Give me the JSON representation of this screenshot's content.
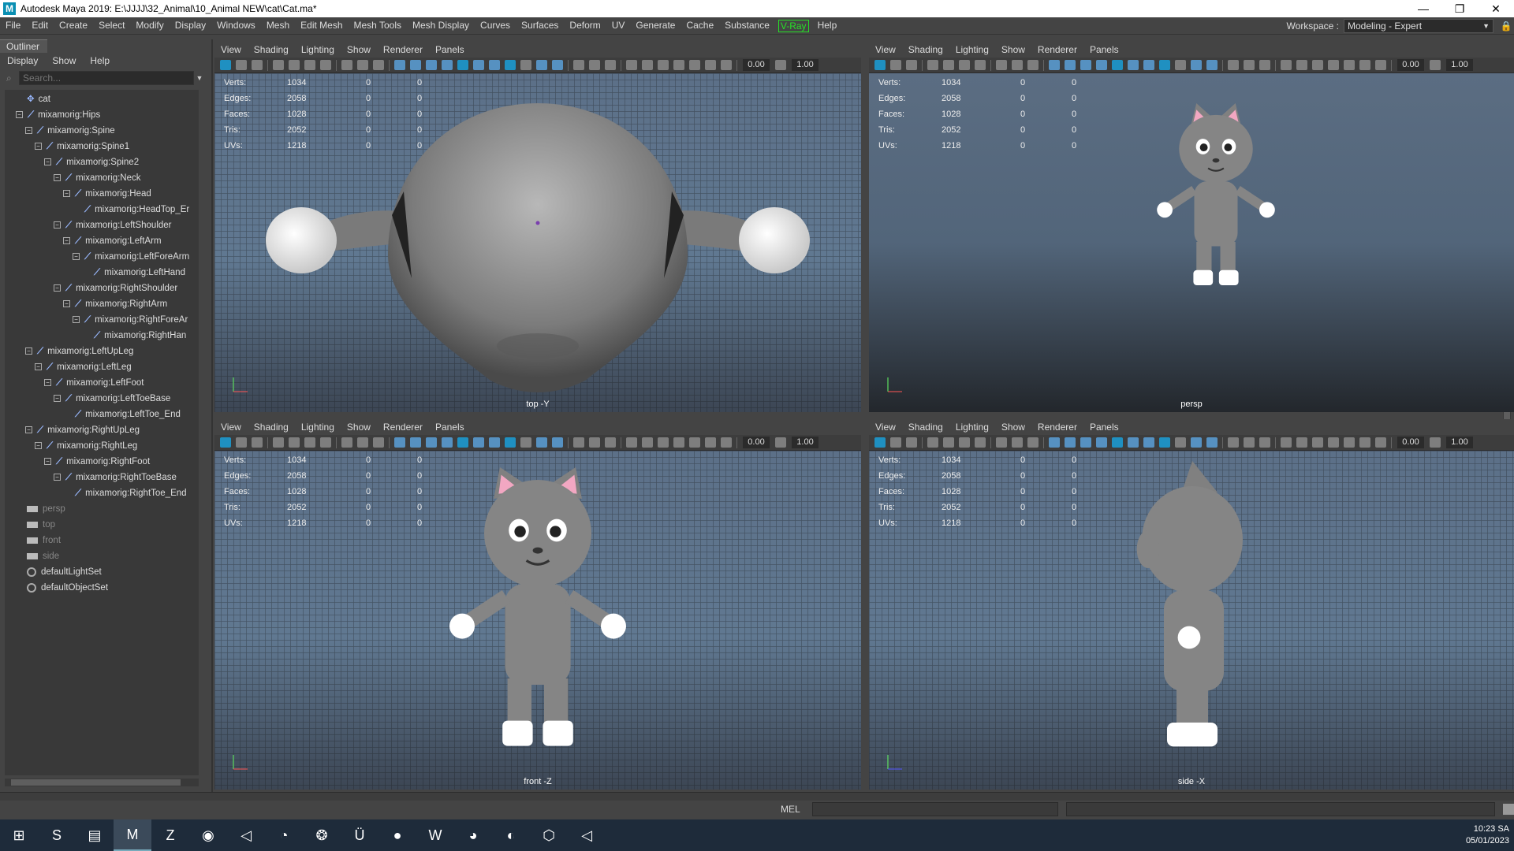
{
  "titlebar": {
    "title": "Autodesk Maya 2019: E:\\JJJJ\\32_Animal\\10_Animal NEW\\cat\\Cat.ma*",
    "logo": "M",
    "minimize": "—",
    "restore": "❐",
    "close": "✕"
  },
  "menubar": {
    "items": [
      "File",
      "Edit",
      "Create",
      "Select",
      "Modify",
      "Display",
      "Windows",
      "Mesh",
      "Edit Mesh",
      "Mesh Tools",
      "Mesh Display",
      "Curves",
      "Surfaces",
      "Deform",
      "UV",
      "Generate",
      "Cache",
      "Substance",
      "V-Ray",
      "Help"
    ],
    "workspace_label": "Workspace :",
    "workspace_value": "Modeling - Expert"
  },
  "outliner": {
    "tab": "Outliner",
    "menu": [
      "Display",
      "Show",
      "Help"
    ],
    "search_placeholder": "Search...",
    "items": [
      {
        "label": "cat",
        "indent": 0,
        "kind": "root"
      },
      {
        "label": "mixamorig:Hips",
        "indent": 0,
        "kind": "joint",
        "exp": true
      },
      {
        "label": "mixamorig:Spine",
        "indent": 1,
        "kind": "joint",
        "exp": true
      },
      {
        "label": "mixamorig:Spine1",
        "indent": 2,
        "kind": "joint",
        "exp": true
      },
      {
        "label": "mixamorig:Spine2",
        "indent": 3,
        "kind": "joint",
        "exp": true
      },
      {
        "label": "mixamorig:Neck",
        "indent": 4,
        "kind": "joint",
        "exp": true
      },
      {
        "label": "mixamorig:Head",
        "indent": 5,
        "kind": "joint",
        "exp": true
      },
      {
        "label": "mixamorig:HeadTop_Er",
        "indent": 6,
        "kind": "joint"
      },
      {
        "label": "mixamorig:LeftShoulder",
        "indent": 4,
        "kind": "joint",
        "exp": true
      },
      {
        "label": "mixamorig:LeftArm",
        "indent": 5,
        "kind": "joint",
        "exp": true
      },
      {
        "label": "mixamorig:LeftForeArm",
        "indent": 6,
        "kind": "joint",
        "exp": true
      },
      {
        "label": "mixamorig:LeftHand",
        "indent": 7,
        "kind": "joint"
      },
      {
        "label": "mixamorig:RightShoulder",
        "indent": 4,
        "kind": "joint",
        "exp": true
      },
      {
        "label": "mixamorig:RightArm",
        "indent": 5,
        "kind": "joint",
        "exp": true
      },
      {
        "label": "mixamorig:RightForeAr",
        "indent": 6,
        "kind": "joint",
        "exp": true
      },
      {
        "label": "mixamorig:RightHan",
        "indent": 7,
        "kind": "joint"
      },
      {
        "label": "mixamorig:LeftUpLeg",
        "indent": 1,
        "kind": "joint",
        "exp": true
      },
      {
        "label": "mixamorig:LeftLeg",
        "indent": 2,
        "kind": "joint",
        "exp": true
      },
      {
        "label": "mixamorig:LeftFoot",
        "indent": 3,
        "kind": "joint",
        "exp": true
      },
      {
        "label": "mixamorig:LeftToeBase",
        "indent": 4,
        "kind": "joint",
        "exp": true
      },
      {
        "label": "mixamorig:LeftToe_End",
        "indent": 5,
        "kind": "joint"
      },
      {
        "label": "mixamorig:RightUpLeg",
        "indent": 1,
        "kind": "joint",
        "exp": true
      },
      {
        "label": "mixamorig:RightLeg",
        "indent": 2,
        "kind": "joint",
        "exp": true
      },
      {
        "label": "mixamorig:RightFoot",
        "indent": 3,
        "kind": "joint",
        "exp": true
      },
      {
        "label": "mixamorig:RightToeBase",
        "indent": 4,
        "kind": "joint",
        "exp": true
      },
      {
        "label": "mixamorig:RightToe_End",
        "indent": 5,
        "kind": "joint"
      },
      {
        "label": "persp",
        "indent": 0,
        "kind": "camera"
      },
      {
        "label": "top",
        "indent": 0,
        "kind": "camera"
      },
      {
        "label": "front",
        "indent": 0,
        "kind": "camera"
      },
      {
        "label": "side",
        "indent": 0,
        "kind": "camera"
      },
      {
        "label": "defaultLightSet",
        "indent": 0,
        "kind": "set"
      },
      {
        "label": "defaultObjectSet",
        "indent": 0,
        "kind": "set"
      }
    ]
  },
  "viewport_menu": [
    "View",
    "Shading",
    "Lighting",
    "Show",
    "Renderer",
    "Panels"
  ],
  "viewport_num1": "0.00",
  "viewport_num2": "1.00",
  "hud": {
    "labels": [
      "Verts:",
      "Edges:",
      "Faces:",
      "Tris:",
      "UVs:"
    ],
    "values": [
      "1034",
      "2058",
      "1028",
      "2052",
      "1218"
    ],
    "zeros": [
      "0",
      "0"
    ]
  },
  "viewports": {
    "top": "top -Y",
    "persp": "persp",
    "front": "front -Z",
    "side": "side -X"
  },
  "cmdline": {
    "lang": "MEL"
  },
  "taskbar": {
    "icons": [
      "windows-start",
      "app-s",
      "file-explorer",
      "maya",
      "zbrush",
      "chrome",
      "unity",
      "blender",
      "app-fish",
      "app-u",
      "github-desktop",
      "app-w",
      "app-chat",
      "app-photo",
      "app-cube",
      "app-play"
    ],
    "glyphs": [
      "⊞",
      "S",
      "▤",
      "M",
      "Z",
      "◉",
      "◁",
      "◔",
      "❂",
      "Ü",
      "●",
      "W",
      "◕",
      "◐",
      "⬡",
      "◁"
    ],
    "time": "10:23 SA",
    "date": "05/01/2023"
  }
}
